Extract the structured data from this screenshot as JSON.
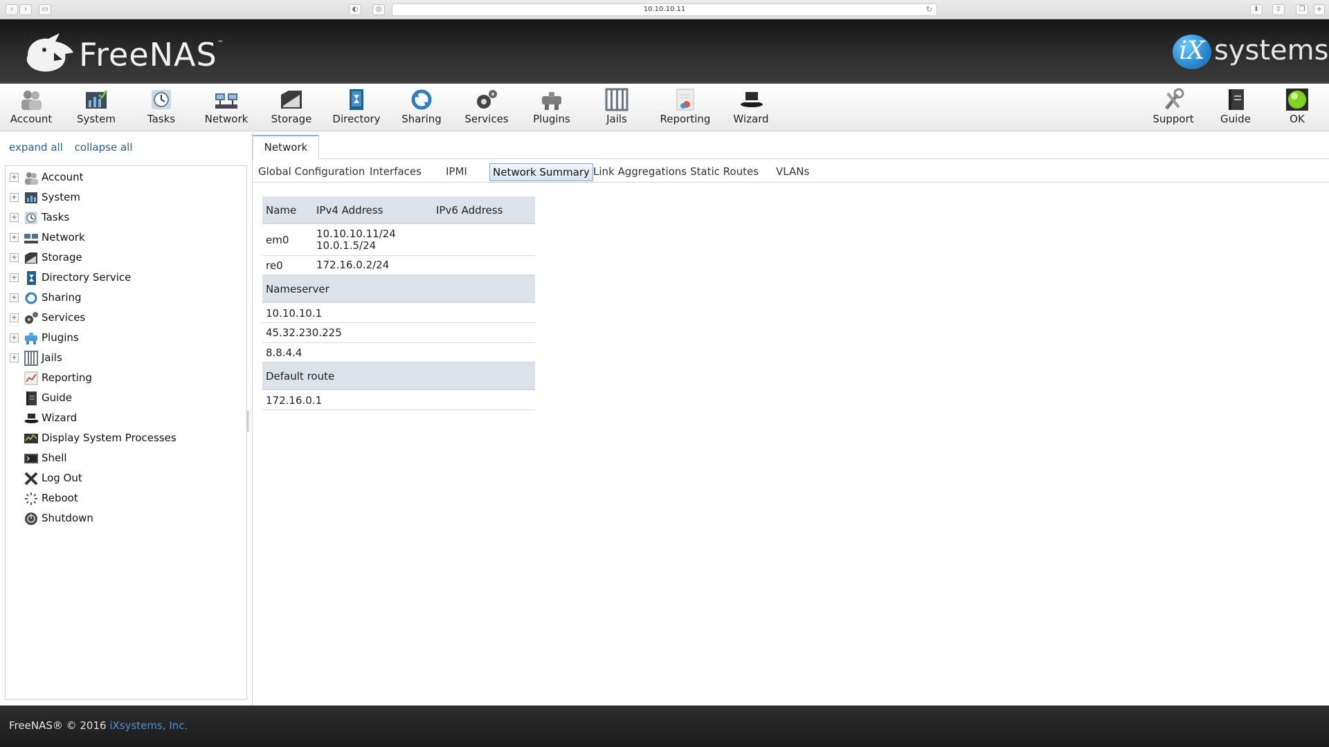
{
  "browser": {
    "url": "10.10.10.11"
  },
  "brand": {
    "name": "FreeNAS",
    "tm": "™",
    "vendor_mark": "iX",
    "vendor_text": "systems",
    "vendor_tm": "™"
  },
  "toolbar": {
    "left": [
      "Account",
      "System",
      "Tasks",
      "Network",
      "Storage",
      "Directory",
      "Sharing",
      "Services",
      "Plugins",
      "Jails",
      "Reporting",
      "Wizard"
    ],
    "right": [
      "Support",
      "Guide",
      "OK"
    ]
  },
  "sidebar": {
    "expand_all": "expand all",
    "collapse_all": "collapse all",
    "items": [
      "Account",
      "System",
      "Tasks",
      "Network",
      "Storage",
      "Directory Service",
      "Sharing",
      "Services",
      "Plugins",
      "Jails",
      "Reporting",
      "Guide",
      "Wizard",
      "Display System Processes",
      "Shell",
      "Log Out",
      "Reboot",
      "Shutdown"
    ]
  },
  "content": {
    "main_tab": "Network",
    "subtabs": [
      "Global Configuration",
      "Interfaces",
      "IPMI",
      "Network Summary",
      "Link Aggregations",
      "Static Routes",
      "VLANs"
    ],
    "active_subtab": "Network Summary"
  },
  "summary": {
    "headers": [
      "Name",
      "IPv4 Address",
      "IPv6 Address"
    ],
    "interfaces": [
      {
        "name": "em0",
        "ipv4_1": "10.10.10.11/24",
        "ipv4_2": "10.0.1.5/24"
      },
      {
        "name": "re0",
        "ipv4_1": "172.16.0.2/24"
      }
    ],
    "nameserver_title": "Nameserver",
    "nameservers": [
      "10.10.10.1",
      "45.32.230.225",
      "8.8.4.4"
    ],
    "default_route_title": "Default route",
    "default_route": "172.16.0.1"
  },
  "footer": {
    "text": "FreeNAS® © 2016",
    "link": "iXsystems, Inc."
  }
}
